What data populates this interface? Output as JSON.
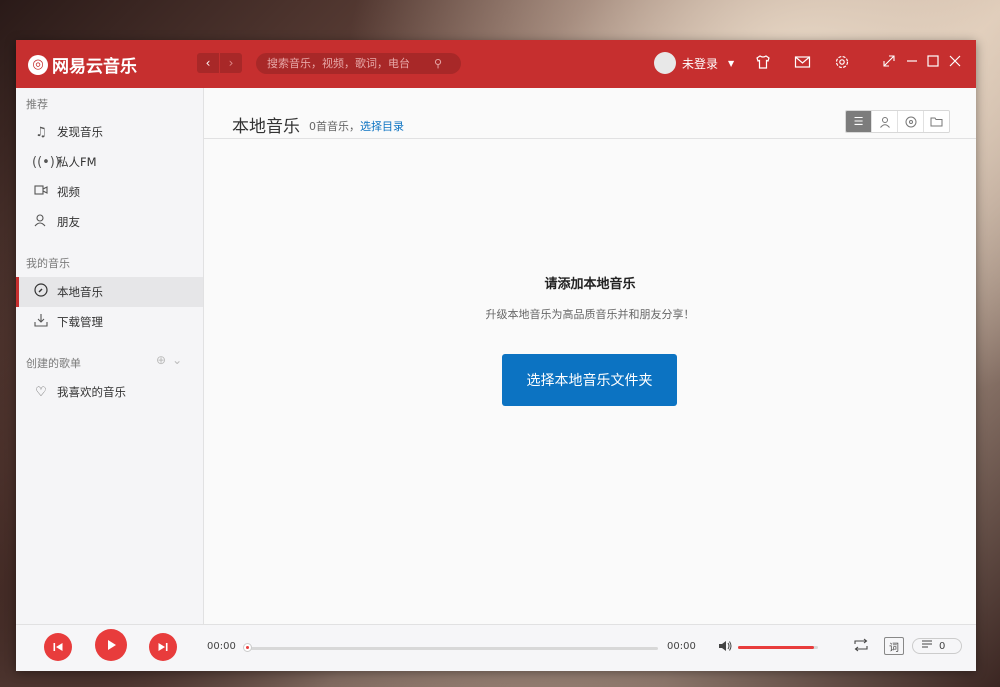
{
  "app": {
    "logo_text": "网易云音乐"
  },
  "search": {
    "placeholder": "搜索音乐，视频，歌词，电台"
  },
  "user": {
    "name": "未登录"
  },
  "sidebar": {
    "section_recommend": "推荐",
    "recommend_items": [
      {
        "label": "发现音乐",
        "icon": "music-note-icon"
      },
      {
        "label": "私人FM",
        "icon": "radio-icon"
      },
      {
        "label": "视频",
        "icon": "video-icon"
      },
      {
        "label": "朋友",
        "icon": "friends-icon"
      }
    ],
    "section_my_music": "我的音乐",
    "my_items": [
      {
        "label": "本地音乐",
        "icon": "disc-icon",
        "active": true
      },
      {
        "label": "下载管理",
        "icon": "download-icon"
      }
    ],
    "section_playlists": "创建的歌单",
    "playlist_items": [
      {
        "label": "我喜欢的音乐",
        "icon": "heart-icon"
      }
    ]
  },
  "main": {
    "title": "本地音乐",
    "count_text": "0首音乐，",
    "choose_dir_link": "选择目录",
    "empty_title": "请添加本地音乐",
    "empty_desc": "升级本地音乐为高品质音乐并和朋友分享！",
    "choose_button": "选择本地音乐文件夹"
  },
  "player": {
    "current_time": "00:00",
    "total_time": "00:00",
    "progress": 0,
    "volume": 0.95,
    "lyric_label": "词",
    "playlist_count": "0"
  },
  "colors": {
    "brand": "#c62f2f",
    "accent_blue": "#0c73c2",
    "player_red": "#e83c3c"
  }
}
